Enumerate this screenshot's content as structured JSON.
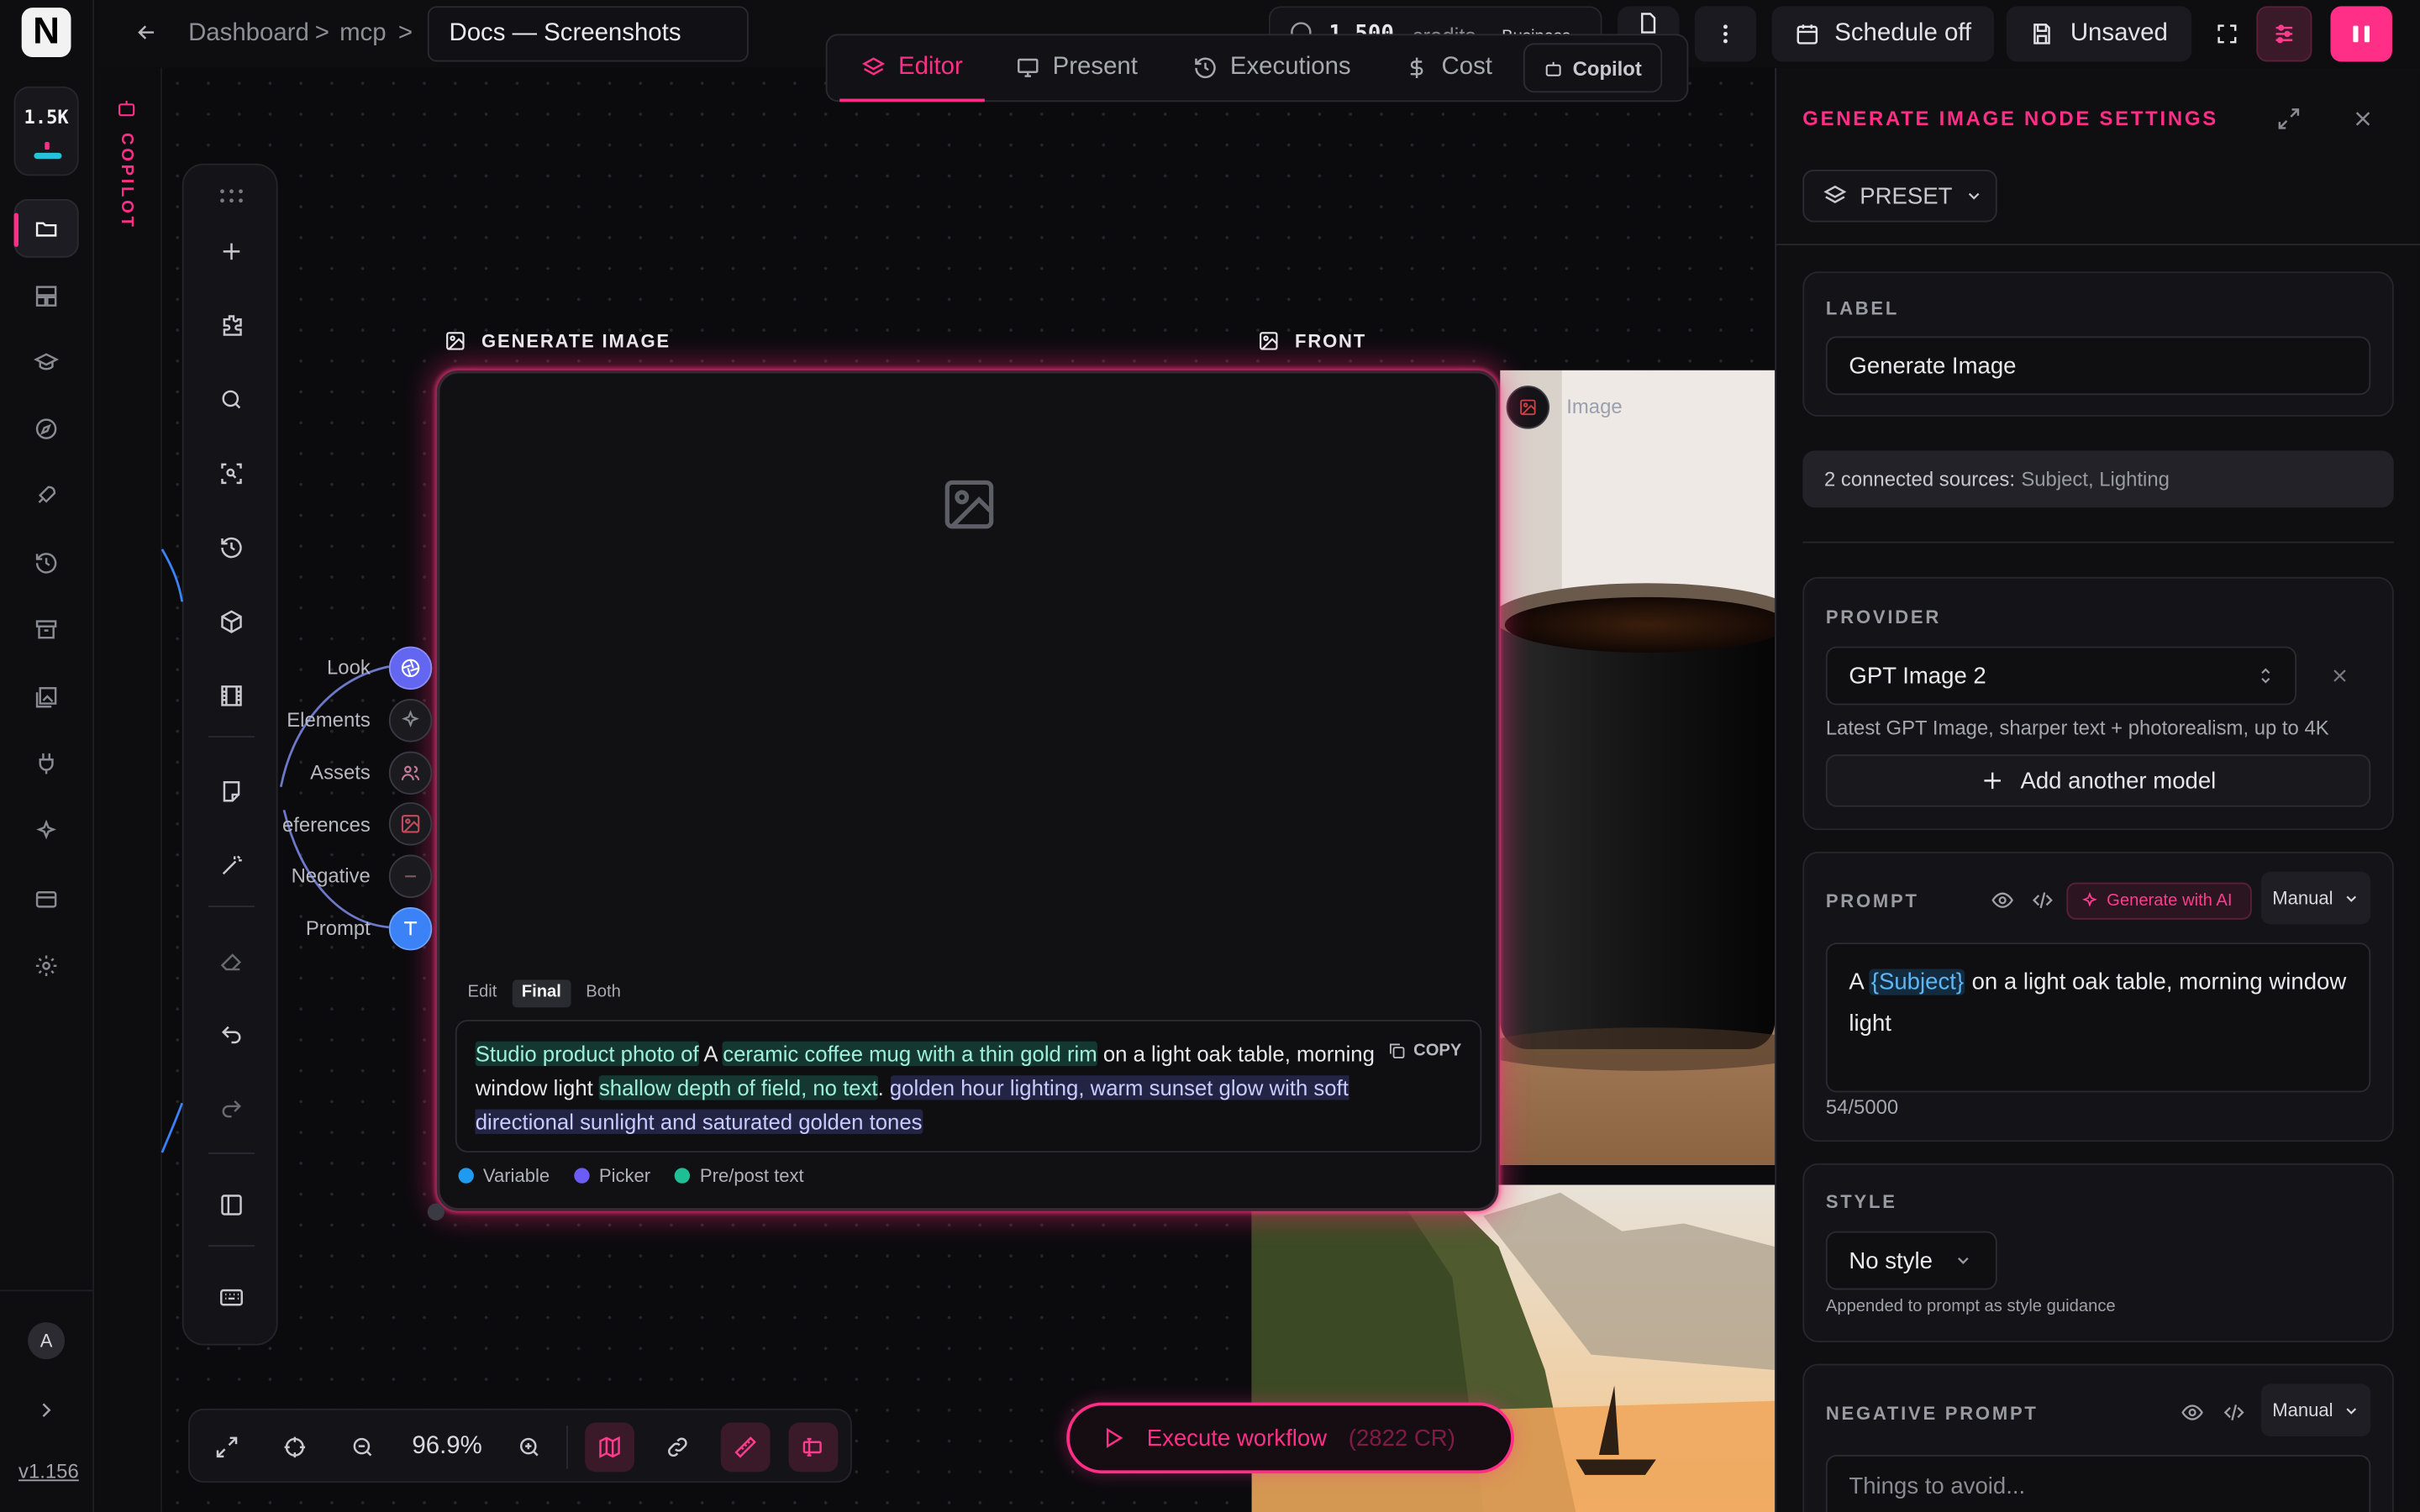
{
  "rail": {
    "logo": "N",
    "credits_short": "1.5K",
    "avatar_initial": "A",
    "version": "v1.156",
    "items": [
      "folder-open-icon",
      "layout-icon",
      "graduation-cap-icon",
      "compass-icon",
      "rocket-icon",
      "history-icon",
      "archive-icon",
      "images-icon",
      "plug-icon",
      "sparkles-icon",
      "credit-card-icon",
      "gear-icon"
    ]
  },
  "copilot_strip": {
    "label": "COPILOT"
  },
  "header": {
    "breadcrumb": [
      "Dashboard",
      "mcp"
    ],
    "separator": ">",
    "title": "Docs — Screenshots",
    "credits": "1,500",
    "credits_unit": "credits",
    "plan": "Business",
    "schedule": "Schedule off",
    "save_status": "Unsaved"
  },
  "tabs": [
    {
      "label": "Editor",
      "active": true,
      "icon": "layers-icon"
    },
    {
      "label": "Present",
      "active": false,
      "icon": "monitor-icon"
    },
    {
      "label": "Executions",
      "active": false,
      "icon": "history-icon"
    },
    {
      "label": "Cost",
      "active": false,
      "icon": "dollar-icon"
    },
    {
      "label": "Copilot",
      "active": false,
      "icon": "bot-icon"
    }
  ],
  "canvas": {
    "node_title": "GENERATE IMAGE",
    "front_title": "FRONT",
    "front_image_label": "Image",
    "ports": [
      "Look",
      "Elements",
      "Assets",
      "eferences",
      "Negative",
      "Prompt"
    ],
    "mode_tabs": [
      "Edit",
      "Final",
      "Both"
    ],
    "mode_selected": "Final",
    "copy_label": "COPY",
    "prompt_segments": {
      "s1": "Studio product photo of",
      "s2": " A ",
      "s3": "ceramic coffee mug with a thin gold rim",
      "s4": " on a light oak table, morning window light ",
      "s5": "shallow depth of field, no text",
      "s6": ". ",
      "s7": "golden hour lighting, warm sunset glow with soft directional sunlight and saturated golden tones"
    },
    "legend": [
      {
        "label": "Variable",
        "color": "#1e9bf0"
      },
      {
        "label": "Picker",
        "color": "#6b5cf5"
      },
      {
        "label": "Pre/post text",
        "color": "#1fbf95"
      }
    ]
  },
  "bottombar": {
    "zoom": "96.9%"
  },
  "execute": {
    "label": "Execute workflow",
    "cost": "(2822 CR)"
  },
  "panel": {
    "title": "GENERATE IMAGE NODE SETTINGS",
    "preset": "PRESET",
    "label_section": "LABEL",
    "label_value": "Generate Image",
    "sources_count": "2 connected sources:",
    "sources_list": "Subject, Lighting",
    "provider_section": "PROVIDER",
    "provider_value": "GPT Image 2",
    "provider_desc": "Latest GPT Image, sharper text + photorealism, up to 4K",
    "add_model": "Add another model",
    "prompt_section": "PROMPT",
    "generate_ai": "Generate with AI",
    "manual": "Manual",
    "prompt_pre": "A ",
    "prompt_var": "{Subject}",
    "prompt_post": " on a light oak table, morning window light",
    "char_count": "54/5000",
    "style_section": "STYLE",
    "style_value": "No style",
    "style_hint": "Appended to prompt as style guidance",
    "negative_section": "NEGATIVE PROMPT",
    "negative_manual": "Manual",
    "negative_placeholder": "Things to avoid..."
  },
  "colors": {
    "accent": "#ff2e86",
    "port_blue": "#3b82f6",
    "port_indigo": "#6366f1"
  }
}
